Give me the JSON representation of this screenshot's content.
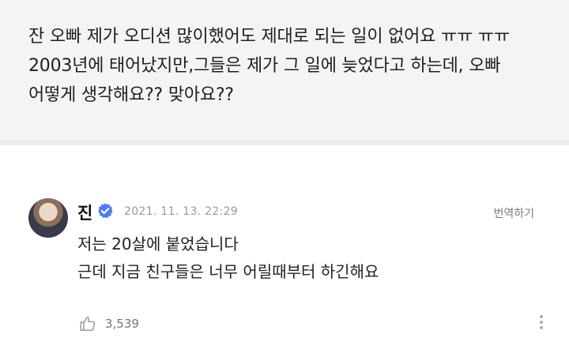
{
  "question": {
    "text": "잔 오빠 제가 오디션 많이했어도 제대로 되는 일이 없어요 ㅠㅠ ㅠㅠ 2003년에 태어났지만,그들은 제가 그 일에 늦었다고 하는데, 오빠 어떻게 생각해요?? 맞아요??"
  },
  "comment": {
    "author": "진",
    "date": "2021. 11. 13. 22:29",
    "translate_label": "번역하기",
    "lines": [
      "저는 20살에 붙었습니다",
      "근데 지금 친구들은 너무 어릴때부터 하긴해요"
    ],
    "like_count": "3,539"
  },
  "icons": {
    "verified": "verified-badge-icon",
    "like": "thumbs-up-icon",
    "more": "more-vertical-icon"
  },
  "colors": {
    "verified": "#4a7cf0",
    "question_bg": "#f4f4f6"
  }
}
